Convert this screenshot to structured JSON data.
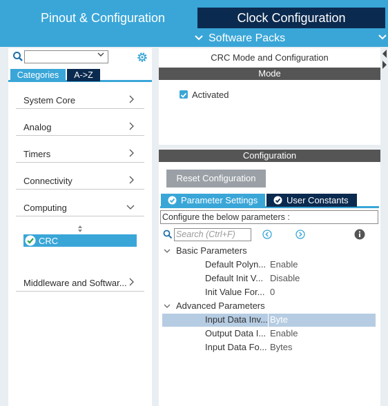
{
  "tabs": {
    "pinout": "Pinout & Configuration",
    "clock": "Clock Configuration"
  },
  "software_packs": "Software Packs",
  "left": {
    "search_value": "",
    "tab_categories": "Categories",
    "tab_az": "A->Z",
    "categories": [
      {
        "label": "System Core"
      },
      {
        "label": "Analog"
      },
      {
        "label": "Timers"
      },
      {
        "label": "Connectivity"
      },
      {
        "label": "Computing"
      },
      {
        "label": "Middleware and Softwar..."
      }
    ],
    "selected_item": "CRC"
  },
  "mode": {
    "title": "CRC Mode and Configuration",
    "header": "Mode",
    "activated_label": "Activated"
  },
  "config": {
    "header": "Configuration",
    "reset_button": "Reset Configuration",
    "tab_params": "Parameter Settings",
    "tab_user": "User Constants",
    "configure_text": "Configure the below parameters :",
    "search_placeholder": "Search (Ctrl+F)",
    "groups": [
      {
        "label": "Basic Parameters",
        "rows": [
          {
            "name": "Default Polyn...",
            "value": "Enable"
          },
          {
            "name": "Default Init V...",
            "value": "Disable"
          },
          {
            "name": "Init Value For...",
            "value": "0"
          }
        ]
      },
      {
        "label": "Advanced Parameters",
        "rows": [
          {
            "name": "Input Data Inv...",
            "value": "Byte"
          },
          {
            "name": "Output Data I...",
            "value": "Enable"
          },
          {
            "name": "Input Data Fo...",
            "value": "Bytes"
          }
        ]
      }
    ]
  },
  "colors": {
    "accent": "#3aa6d8",
    "dark_navy": "#0b2a4f",
    "header_gray": "#555555",
    "selection": "#b6cce2"
  }
}
